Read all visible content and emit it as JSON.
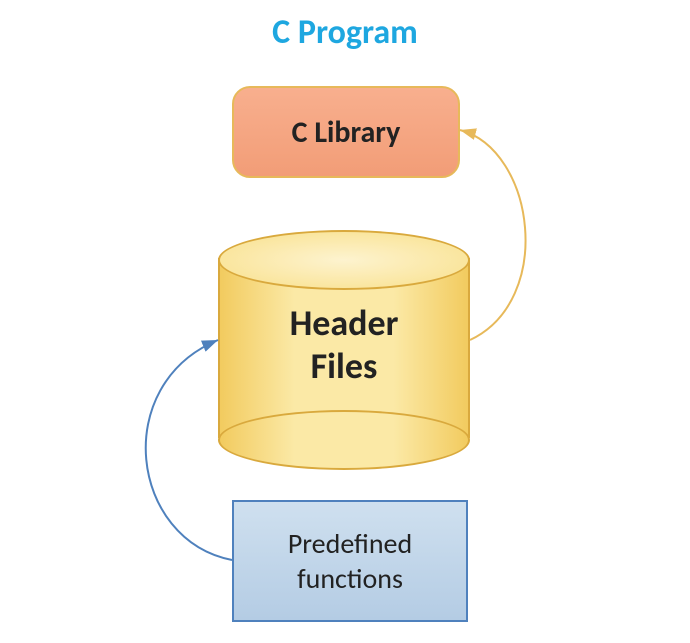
{
  "title": "C Program",
  "nodes": {
    "library": {
      "label": "C Library"
    },
    "header_files": {
      "label_line1": "Header",
      "label_line2": "Files"
    },
    "predefined_functions": {
      "label_line1": "Predefined",
      "label_line2": "functions"
    }
  },
  "arrows": [
    {
      "from": "predefined_functions",
      "to": "header_files",
      "color": "#4f81bd"
    },
    {
      "from": "header_files",
      "to": "library",
      "color": "#e7b95a"
    }
  ],
  "colors": {
    "title": "#1ea7e0",
    "library_fill": "#f29d77",
    "cylinder_fill": "#fbe9a6",
    "functions_fill": "#b4cce4",
    "arrow_blue": "#4f81bd",
    "arrow_orange": "#e7b95a"
  }
}
